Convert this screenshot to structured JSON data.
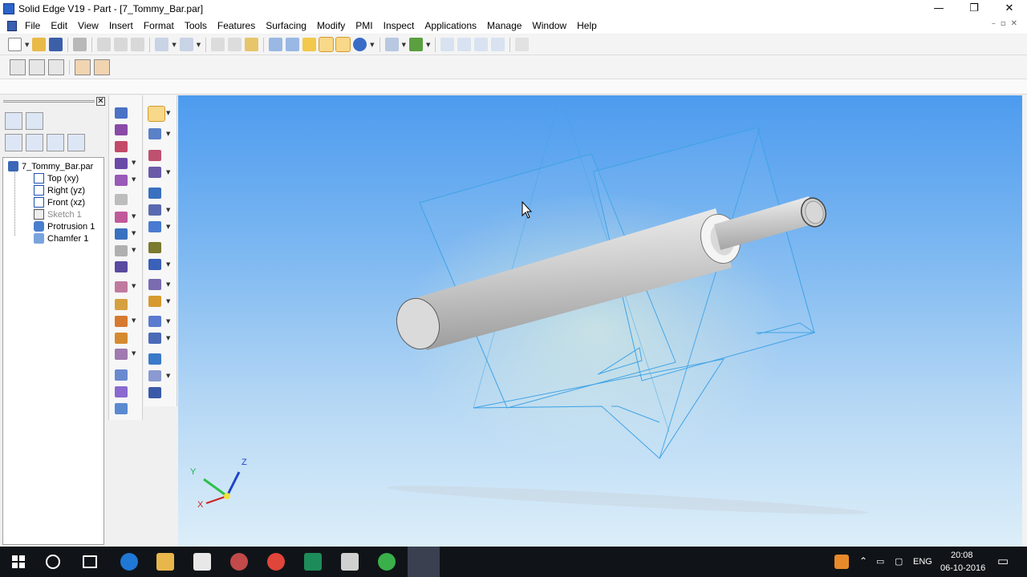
{
  "window": {
    "title": "Solid Edge V19 - Part - [7_Tommy_Bar.par]",
    "controls": [
      "—",
      "❐",
      "✕"
    ]
  },
  "menu": [
    "File",
    "Edit",
    "View",
    "Insert",
    "Format",
    "Tools",
    "Features",
    "Surfacing",
    "Modify",
    "PMI",
    "Inspect",
    "Applications",
    "Manage",
    "Window",
    "Help"
  ],
  "mdi_controls": [
    "–",
    "▫",
    "✕"
  ],
  "pathfinder": {
    "close_label": "✕",
    "tree": [
      {
        "label": "7_Tommy_Bar.par",
        "icon": "part-icon",
        "enabled": true
      },
      {
        "label": "Top (xy)",
        "icon": "plane-icon",
        "enabled": true
      },
      {
        "label": "Right (yz)",
        "icon": "plane-icon",
        "enabled": true
      },
      {
        "label": "Front (xz)",
        "icon": "plane-icon",
        "enabled": true
      },
      {
        "label": "Sketch 1",
        "icon": "sketch-icon",
        "enabled": false
      },
      {
        "label": "Protrusion 1",
        "icon": "protrusion-icon",
        "enabled": true
      },
      {
        "label": "Chamfer 1",
        "icon": "chamfer-icon",
        "enabled": true
      }
    ]
  },
  "axis_triad": {
    "x": "X",
    "y": "Y",
    "z": "Z"
  },
  "taskbar": {
    "language": "ENG",
    "time": "20:08",
    "date": "06-10-2016"
  },
  "colors": {
    "viewport_top": "#4d9bef",
    "viewport_bottom": "#dceef9",
    "plane_lines": "#3fa3e6",
    "selected_tool": "#f8d889"
  }
}
